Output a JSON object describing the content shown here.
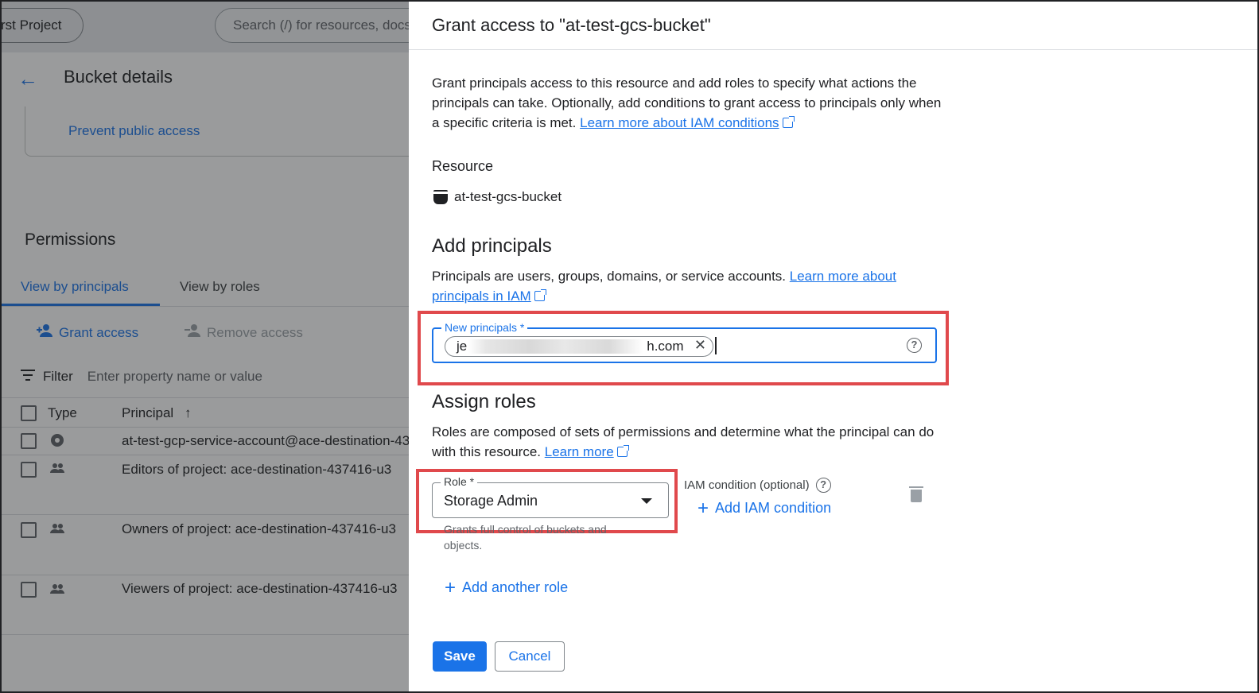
{
  "background": {
    "project_label": "rst Project",
    "search_placeholder": "Search (/) for resources, docs",
    "page_title": "Bucket details",
    "prevent_public_access": "Prevent public access",
    "permissions_title": "Permissions",
    "tabs": [
      {
        "label": "View by principals"
      },
      {
        "label": "View by roles"
      }
    ],
    "grant_access": "Grant access",
    "remove_access": "Remove access",
    "filter_label": "Filter",
    "filter_placeholder": "Enter property name or value",
    "columns": {
      "type": "Type",
      "principal": "Principal"
    },
    "rows": [
      {
        "principal": "at-test-gcp-service-account@ace-destination-43"
      },
      {
        "principal": "Editors of project: ace-destination-437416-u3"
      },
      {
        "principal": "Owners of project: ace-destination-437416-u3"
      },
      {
        "principal": "Viewers of project: ace-destination-437416-u3"
      }
    ]
  },
  "panel": {
    "title": "Grant access to \"at-test-gcs-bucket\"",
    "description": "Grant principals access to this resource and add roles to specify what actions the principals can take. Optionally, add conditions to grant access to principals only when a specific criteria is met.",
    "iam_conditions_link": "Learn more about IAM conditions",
    "resource_label": "Resource",
    "resource_name": "at-test-gcs-bucket",
    "add_principals_title": "Add principals",
    "principals_desc": "Principals are users, groups, domains, or service accounts.",
    "principals_link": "Learn more about principals in IAM",
    "new_principals_label": "New principals *",
    "chip_prefix": "je",
    "chip_suffix": "h.com",
    "assign_roles_title": "Assign roles",
    "roles_desc": "Roles are composed of sets of permissions and determine what the principal can do with this resource.",
    "roles_link": "Learn more",
    "role_label": "Role *",
    "role_value": "Storage Admin",
    "role_hint": "Grants full control of buckets and objects.",
    "iam_condition_label": "IAM condition (optional)",
    "add_iam_condition": "Add IAM condition",
    "add_another_role": "Add another role",
    "save": "Save",
    "cancel": "Cancel"
  },
  "colors": {
    "accent": "#1a73e8",
    "highlight": "#e0494c"
  }
}
